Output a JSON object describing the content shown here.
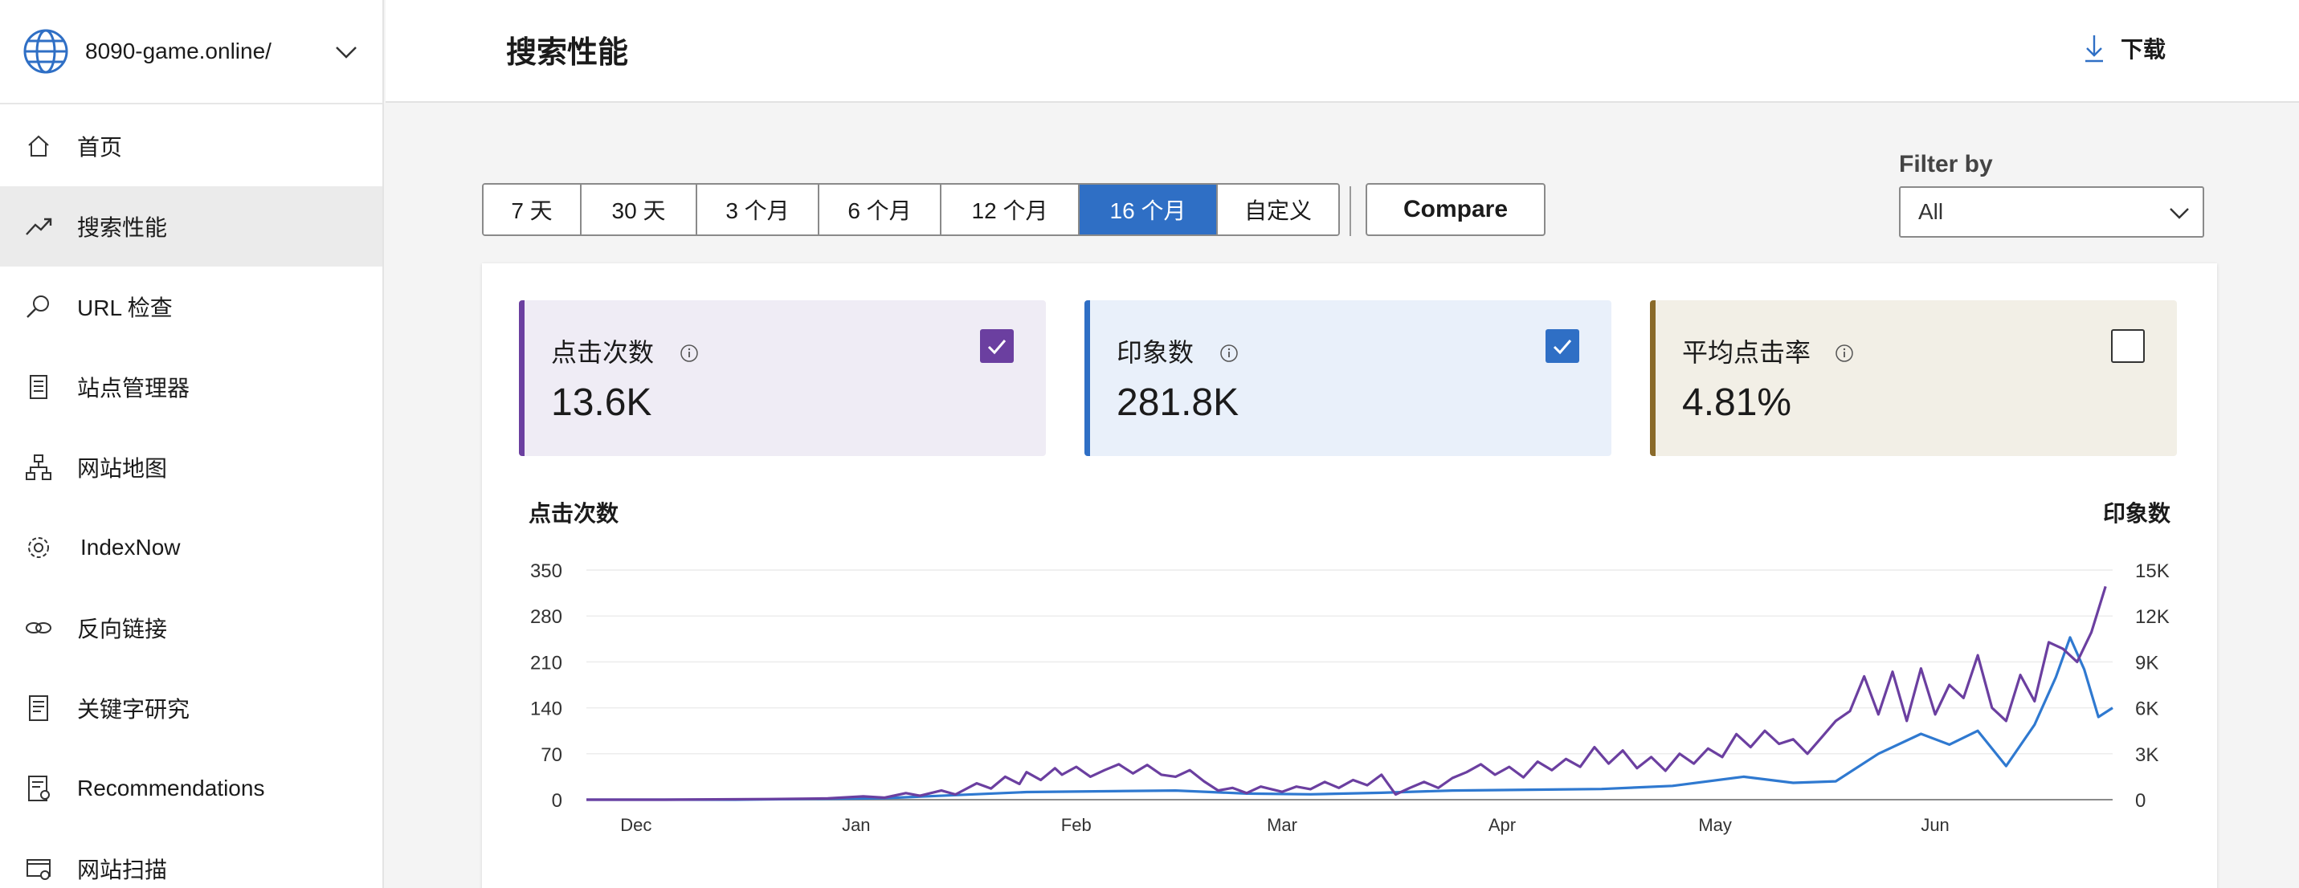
{
  "site": {
    "name": "8090-game.online/"
  },
  "sidebar": {
    "items": [
      {
        "label": "首页",
        "icon": "home-icon"
      },
      {
        "label": "搜索性能",
        "icon": "trend-icon"
      },
      {
        "label": "URL 检查",
        "icon": "search-icon"
      },
      {
        "label": "站点管理器",
        "icon": "checklist-icon"
      },
      {
        "label": "网站地图",
        "icon": "sitemap-icon"
      },
      {
        "label": "IndexNow",
        "icon": "gear-icon"
      },
      {
        "label": "反向链接",
        "icon": "link-icon"
      },
      {
        "label": "关键字研究",
        "icon": "document-icon"
      },
      {
        "label": "Recommendations",
        "icon": "report-icon"
      },
      {
        "label": "网站扫描",
        "icon": "scan-icon"
      }
    ],
    "active_index": 1
  },
  "header": {
    "title": "搜索性能",
    "download_label": "下载"
  },
  "date_range": {
    "options": [
      "7 天",
      "30 天",
      "3 个月",
      "6 个月",
      "12 个月",
      "16 个月",
      "自定义"
    ],
    "selected": "16 个月",
    "compare_label": "Compare"
  },
  "filter": {
    "label": "Filter by",
    "value": "All"
  },
  "metrics": [
    {
      "label": "点击次数",
      "value": "13.6K",
      "checked": true,
      "color": "#6b3fa0",
      "bg": "#efecf5"
    },
    {
      "label": "印象数",
      "value": "281.8K",
      "checked": true,
      "color": "#2f6fc5",
      "bg": "#e9f0fa"
    },
    {
      "label": "平均点击率",
      "value": "4.81%",
      "checked": false,
      "color": "#8a6a2a",
      "bg": "#f2efe6"
    }
  ],
  "chart_data": {
    "type": "line",
    "y_left_title": "点击次数",
    "y_right_title": "印象数",
    "y_left_ticks": [
      "350",
      "280",
      "210",
      "140",
      "70",
      "0"
    ],
    "y_right_ticks": [
      "15K",
      "12K",
      "9K",
      "6K",
      "3K",
      "0"
    ],
    "y_left_range": [
      0,
      350
    ],
    "y_right_range": [
      0,
      15000
    ],
    "x_ticks": [
      {
        "label": "Dec",
        "date": "2023-12-01"
      },
      {
        "label": "Jan",
        "date": "2024-01-01"
      },
      {
        "label": "Feb",
        "date": "2024-02-01"
      },
      {
        "label": "Mar",
        "date": "2024-03-01"
      },
      {
        "label": "Apr",
        "date": "2024-04-01"
      },
      {
        "label": "May",
        "date": "2024-05-01"
      },
      {
        "label": "Jun",
        "date": "2024-06-01"
      }
    ],
    "x_range": [
      "2023-11-24",
      "2024-06-26"
    ],
    "grid": true,
    "series": [
      {
        "name": "点击次数",
        "axis": "left",
        "color": "#6b3fa0",
        "points": [
          [
            "2023-11-24",
            0
          ],
          [
            "2023-12-05",
            0
          ],
          [
            "2023-12-20",
            1
          ],
          [
            "2023-12-28",
            2
          ],
          [
            "2024-01-02",
            5
          ],
          [
            "2024-01-05",
            3
          ],
          [
            "2024-01-08",
            10
          ],
          [
            "2024-01-10",
            6
          ],
          [
            "2024-01-13",
            14
          ],
          [
            "2024-01-15",
            8
          ],
          [
            "2024-01-18",
            25
          ],
          [
            "2024-01-20",
            17
          ],
          [
            "2024-01-22",
            35
          ],
          [
            "2024-01-24",
            24
          ],
          [
            "2024-01-25",
            42
          ],
          [
            "2024-01-27",
            30
          ],
          [
            "2024-01-29",
            48
          ],
          [
            "2024-01-30",
            38
          ],
          [
            "2024-02-01",
            50
          ],
          [
            "2024-02-03",
            35
          ],
          [
            "2024-02-05",
            45
          ],
          [
            "2024-02-07",
            54
          ],
          [
            "2024-02-09",
            40
          ],
          [
            "2024-02-11",
            53
          ],
          [
            "2024-02-13",
            38
          ],
          [
            "2024-02-15",
            35
          ],
          [
            "2024-02-17",
            45
          ],
          [
            "2024-02-19",
            28
          ],
          [
            "2024-02-21",
            14
          ],
          [
            "2024-02-23",
            18
          ],
          [
            "2024-02-25",
            10
          ],
          [
            "2024-02-27",
            20
          ],
          [
            "2024-03-01",
            12
          ],
          [
            "2024-03-03",
            20
          ],
          [
            "2024-03-05",
            16
          ],
          [
            "2024-03-07",
            27
          ],
          [
            "2024-03-09",
            18
          ],
          [
            "2024-03-11",
            30
          ],
          [
            "2024-03-13",
            22
          ],
          [
            "2024-03-15",
            38
          ],
          [
            "2024-03-17",
            8
          ],
          [
            "2024-03-19",
            18
          ],
          [
            "2024-03-21",
            27
          ],
          [
            "2024-03-23",
            18
          ],
          [
            "2024-03-25",
            33
          ],
          [
            "2024-03-27",
            42
          ],
          [
            "2024-03-29",
            54
          ],
          [
            "2024-03-31",
            38
          ],
          [
            "2024-04-02",
            50
          ],
          [
            "2024-04-04",
            34
          ],
          [
            "2024-04-06",
            58
          ],
          [
            "2024-04-08",
            45
          ],
          [
            "2024-04-10",
            62
          ],
          [
            "2024-04-12",
            50
          ],
          [
            "2024-04-14",
            80
          ],
          [
            "2024-04-16",
            55
          ],
          [
            "2024-04-18",
            75
          ],
          [
            "2024-04-20",
            48
          ],
          [
            "2024-04-22",
            65
          ],
          [
            "2024-04-24",
            44
          ],
          [
            "2024-04-26",
            70
          ],
          [
            "2024-04-28",
            55
          ],
          [
            "2024-04-30",
            78
          ],
          [
            "2024-05-02",
            65
          ],
          [
            "2024-05-04",
            100
          ],
          [
            "2024-05-06",
            80
          ],
          [
            "2024-05-08",
            105
          ],
          [
            "2024-05-10",
            85
          ],
          [
            "2024-05-12",
            92
          ],
          [
            "2024-05-14",
            70
          ],
          [
            "2024-05-16",
            95
          ],
          [
            "2024-05-18",
            120
          ],
          [
            "2024-05-20",
            135
          ],
          [
            "2024-05-22",
            188
          ],
          [
            "2024-05-24",
            130
          ],
          [
            "2024-05-26",
            195
          ],
          [
            "2024-05-28",
            120
          ],
          [
            "2024-05-30",
            200
          ],
          [
            "2024-06-01",
            130
          ],
          [
            "2024-06-03",
            175
          ],
          [
            "2024-06-05",
            155
          ],
          [
            "2024-06-07",
            220
          ],
          [
            "2024-06-09",
            140
          ],
          [
            "2024-06-11",
            120
          ],
          [
            "2024-06-13",
            190
          ],
          [
            "2024-06-15",
            150
          ],
          [
            "2024-06-17",
            240
          ],
          [
            "2024-06-19",
            230
          ],
          [
            "2024-06-21",
            210
          ],
          [
            "2024-06-23",
            255
          ],
          [
            "2024-06-25",
            325
          ]
        ]
      },
      {
        "name": "印象数",
        "axis": "right",
        "color": "#2f79d0",
        "points": [
          [
            "2023-11-24",
            0
          ],
          [
            "2023-12-15",
            0
          ],
          [
            "2024-01-05",
            100
          ],
          [
            "2024-01-15",
            300
          ],
          [
            "2024-01-25",
            500
          ],
          [
            "2024-02-05",
            550
          ],
          [
            "2024-02-15",
            600
          ],
          [
            "2024-02-25",
            400
          ],
          [
            "2024-03-05",
            350
          ],
          [
            "2024-03-15",
            450
          ],
          [
            "2024-03-25",
            600
          ],
          [
            "2024-04-05",
            650
          ],
          [
            "2024-04-15",
            700
          ],
          [
            "2024-04-25",
            900
          ],
          [
            "2024-05-05",
            1500
          ],
          [
            "2024-05-12",
            1100
          ],
          [
            "2024-05-18",
            1200
          ],
          [
            "2024-05-24",
            3000
          ],
          [
            "2024-05-30",
            4300
          ],
          [
            "2024-06-03",
            3600
          ],
          [
            "2024-06-07",
            4500
          ],
          [
            "2024-06-11",
            2200
          ],
          [
            "2024-06-15",
            4900
          ],
          [
            "2024-06-18",
            8000
          ],
          [
            "2024-06-20",
            10600
          ],
          [
            "2024-06-22",
            8500
          ],
          [
            "2024-06-24",
            5400
          ],
          [
            "2024-06-26",
            6000
          ]
        ]
      }
    ]
  }
}
